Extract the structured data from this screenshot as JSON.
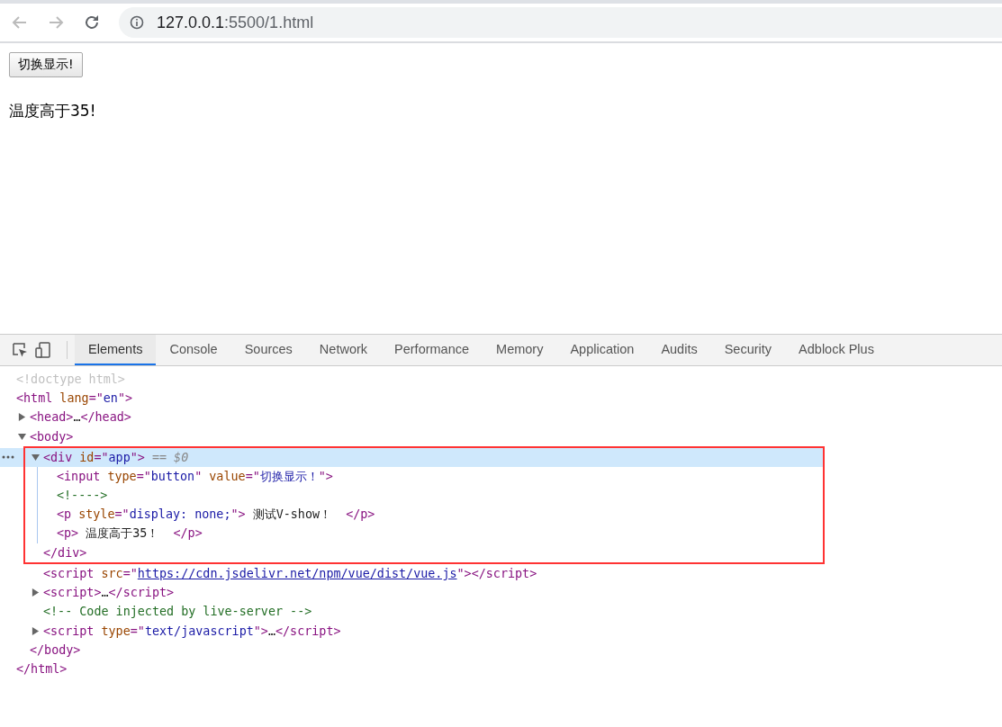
{
  "browser": {
    "url_host": "127.0.0.1",
    "url_rest": ":5500/1.html"
  },
  "page": {
    "button": "切换显示!",
    "paragraph": "温度高于35!"
  },
  "devtools": {
    "tabs": [
      {
        "label": "Elements",
        "selected": true
      },
      {
        "label": "Console",
        "selected": false
      },
      {
        "label": "Sources",
        "selected": false
      },
      {
        "label": "Network",
        "selected": false
      },
      {
        "label": "Performance",
        "selected": false
      },
      {
        "label": "Memory",
        "selected": false
      },
      {
        "label": "Application",
        "selected": false
      },
      {
        "label": "Audits",
        "selected": false
      },
      {
        "label": "Security",
        "selected": false
      },
      {
        "label": "Adblock Plus",
        "selected": false
      }
    ],
    "tree": [
      {
        "selected": false,
        "tokens": [
          {
            "kind": "doctype",
            "text": "<!doctype html>"
          }
        ]
      },
      {
        "selected": false,
        "tokens": [
          {
            "kind": "tag",
            "text": "<html"
          },
          {
            "kind": "attr",
            "text": " lang"
          },
          {
            "kind": "punct",
            "text": "=\""
          },
          {
            "kind": "value",
            "text": "en"
          },
          {
            "kind": "punct",
            "text": "\">"
          }
        ],
        "closing": [
          {
            "kind": "tag",
            "text": "</html>"
          }
        ],
        "children": [
          {
            "expanded": false,
            "selected": false,
            "tokens": [
              {
                "kind": "tag",
                "text": "<head>"
              },
              {
                "kind": "text",
                "text": "…"
              },
              {
                "kind": "tag",
                "text": "</head>"
              }
            ]
          },
          {
            "expanded": true,
            "selected": false,
            "tokens": [
              {
                "kind": "tag",
                "text": "<body>"
              }
            ],
            "closing": [
              {
                "kind": "tag",
                "text": "</body>"
              }
            ],
            "children": [
              {
                "expanded": true,
                "selected": true,
                "outlined": true,
                "tokens": [
                  {
                    "kind": "tag",
                    "text": "<div"
                  },
                  {
                    "kind": "attr",
                    "text": " id"
                  },
                  {
                    "kind": "punct",
                    "text": "=\""
                  },
                  {
                    "kind": "value",
                    "text": "app"
                  },
                  {
                    "kind": "punct",
                    "text": "\">"
                  },
                  {
                    "kind": "note",
                    "text": " == $0"
                  }
                ],
                "closing": [
                  {
                    "kind": "tag",
                    "text": "</div>"
                  }
                ],
                "children": [
                  {
                    "selected": false,
                    "tokens": [
                      {
                        "kind": "tag",
                        "text": "<input"
                      },
                      {
                        "kind": "attr",
                        "text": " type"
                      },
                      {
                        "kind": "punct",
                        "text": "=\""
                      },
                      {
                        "kind": "value",
                        "text": "button"
                      },
                      {
                        "kind": "punct",
                        "text": "\""
                      },
                      {
                        "kind": "attr",
                        "text": " value"
                      },
                      {
                        "kind": "punct",
                        "text": "=\""
                      },
                      {
                        "kind": "value",
                        "text": "切换显示！"
                      },
                      {
                        "kind": "punct",
                        "text": "\">"
                      }
                    ]
                  },
                  {
                    "selected": false,
                    "tokens": [
                      {
                        "kind": "comment",
                        "text": "<!---->"
                      }
                    ]
                  },
                  {
                    "selected": false,
                    "tokens": [
                      {
                        "kind": "tag",
                        "text": "<p"
                      },
                      {
                        "kind": "attr",
                        "text": " style"
                      },
                      {
                        "kind": "punct",
                        "text": "=\""
                      },
                      {
                        "kind": "value",
                        "text": "display: none;"
                      },
                      {
                        "kind": "punct",
                        "text": "\">"
                      },
                      {
                        "kind": "text",
                        "text": " 测试V-show！  "
                      },
                      {
                        "kind": "tag",
                        "text": "</p>"
                      }
                    ]
                  },
                  {
                    "selected": false,
                    "tokens": [
                      {
                        "kind": "tag",
                        "text": "<p>"
                      },
                      {
                        "kind": "text",
                        "text": " 温度高于35！  "
                      },
                      {
                        "kind": "tag",
                        "text": "</p>"
                      }
                    ]
                  }
                ]
              },
              {
                "selected": false,
                "tokens": [
                  {
                    "kind": "tag",
                    "text": "<script"
                  },
                  {
                    "kind": "attr",
                    "text": " src"
                  },
                  {
                    "kind": "punct",
                    "text": "=\""
                  },
                  {
                    "kind": "link",
                    "text": "https://cdn.jsdelivr.net/npm/vue/dist/vue.js"
                  },
                  {
                    "kind": "punct",
                    "text": "\">"
                  },
                  {
                    "kind": "tag",
                    "text": "</script>"
                  }
                ]
              },
              {
                "expanded": false,
                "selected": false,
                "tokens": [
                  {
                    "kind": "tag",
                    "text": "<script>"
                  },
                  {
                    "kind": "text",
                    "text": "…"
                  },
                  {
                    "kind": "tag",
                    "text": "</script>"
                  }
                ]
              },
              {
                "selected": false,
                "tokens": [
                  {
                    "kind": "comment",
                    "text": "<!-- Code injected by live-server -->"
                  }
                ]
              },
              {
                "expanded": false,
                "selected": false,
                "tokens": [
                  {
                    "kind": "tag",
                    "text": "<script"
                  },
                  {
                    "kind": "attr",
                    "text": " type"
                  },
                  {
                    "kind": "punct",
                    "text": "=\""
                  },
                  {
                    "kind": "value",
                    "text": "text/javascript"
                  },
                  {
                    "kind": "punct",
                    "text": "\">"
                  },
                  {
                    "kind": "text",
                    "text": "…"
                  },
                  {
                    "kind": "tag",
                    "text": "</script>"
                  }
                ]
              }
            ]
          }
        ]
      }
    ]
  }
}
